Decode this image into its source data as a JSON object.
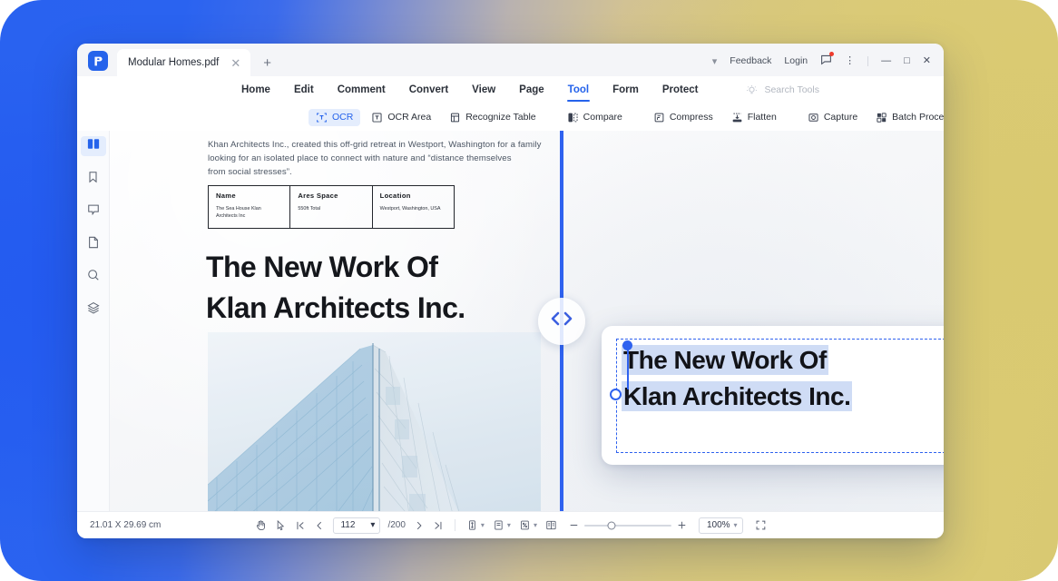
{
  "background": {
    "left_color": "#2962f0",
    "right_color": "#d9c972"
  },
  "titlebar": {
    "logo_icon": "pdfelement-logo-icon",
    "tab_title": "Modular Homes.pdf",
    "tab_close_icon": "close-icon",
    "new_tab_icon": "plus-icon",
    "expand_icon": "chevron-down-icon",
    "feedback_label": "Feedback",
    "login_label": "Login",
    "message_icon": "message-badge-icon",
    "more_icon": "more-vertical-icon",
    "minimize_icon": "minimize-icon",
    "maximize_icon": "maximize-icon",
    "close_icon": "window-close-icon"
  },
  "menubar": {
    "items": [
      {
        "label": "Home",
        "active": false
      },
      {
        "label": "Edit",
        "active": false
      },
      {
        "label": "Comment",
        "active": false
      },
      {
        "label": "Convert",
        "active": false
      },
      {
        "label": "View",
        "active": false
      },
      {
        "label": "Page",
        "active": false
      },
      {
        "label": "Tool",
        "active": true
      },
      {
        "label": "Form",
        "active": false
      },
      {
        "label": "Protect",
        "active": false
      }
    ],
    "search_icon": "lightbulb-icon",
    "search_placeholder": "Search Tools"
  },
  "toolbar": {
    "items": [
      {
        "label": "OCR",
        "icon": "ocr-icon",
        "active": true
      },
      {
        "label": "OCR Area",
        "icon": "ocr-area-icon",
        "active": false
      },
      {
        "label": "Recognize Table",
        "icon": "recognize-table-icon",
        "active": false
      },
      {
        "label": "Compare",
        "icon": "compare-icon",
        "active": false
      },
      {
        "label": "Compress",
        "icon": "compress-icon",
        "active": false
      },
      {
        "label": "Flatten",
        "icon": "flatten-icon",
        "active": false
      },
      {
        "label": "Capture",
        "icon": "capture-icon",
        "active": false
      },
      {
        "label": "Batch Process",
        "icon": "batch-process-icon",
        "active": false
      }
    ]
  },
  "sidebar": {
    "items": [
      {
        "name": "thumbnails",
        "icon": "thumbnails-icon",
        "active": true
      },
      {
        "name": "bookmarks",
        "icon": "bookmark-icon",
        "active": false
      },
      {
        "name": "comments",
        "icon": "comment-icon",
        "active": false
      },
      {
        "name": "attachments",
        "icon": "attachment-page-icon",
        "active": false
      },
      {
        "name": "search",
        "icon": "search-icon",
        "active": false
      },
      {
        "name": "layers",
        "icon": "layers-icon",
        "active": false
      }
    ]
  },
  "document": {
    "paragraph_part1": "Khan Architects Inc., created this off-grid retreat in Westport, Washington for a family looking for an isolated place to connect with nature and “distance themselves",
    "paragraph_part2": "from social stresses”.",
    "table": {
      "headers": [
        "Name",
        "Ares Space",
        "Location"
      ],
      "values": [
        "The Sea House Klan Architects Inc",
        "550ft Total",
        "Westport, Washington, USA"
      ],
      "highlighted_columns": [
        1,
        2
      ],
      "highlight_color": "#fbe48c"
    },
    "title_line1": "The New Work Of",
    "title_line2": "Klan Architects Inc.",
    "photo_alt": "glass-skyscraper-photo"
  },
  "splitter": {
    "handle_icon": "compare-chevrons-icon",
    "color": "#2f62ef"
  },
  "selection_card": {
    "line1": "The New Work Of",
    "line2": "Klan Architects Inc.",
    "border_color": "#2f62ef",
    "highlight_color": "#cfdcf5",
    "handles": [
      "top-left-fill",
      "left-middle-hollow",
      "right-middle-hollow",
      "bottom-right-fill"
    ]
  },
  "statusbar": {
    "page_dimensions": "21.01 X 29.69 cm",
    "hand_tool_icon": "hand-icon",
    "select_tool_icon": "select-cursor-icon",
    "first_page_icon": "first-page-icon",
    "prev_page_icon": "prev-page-icon",
    "current_page": "112",
    "total_pages": "/200",
    "next_page_icon": "next-page-icon",
    "last_page_icon": "last-page-icon",
    "scroll_mode_icon": "vertical-scroll-icon",
    "page_layout_icon": "single-page-icon",
    "fit_mode_icon": "fit-page-icon",
    "two_page_icon": "two-page-view-icon",
    "zoom_out_icon": "minus-icon",
    "zoom_in_icon": "plus-icon",
    "zoom_level": "100%",
    "fullscreen_icon": "fullscreen-icon"
  }
}
